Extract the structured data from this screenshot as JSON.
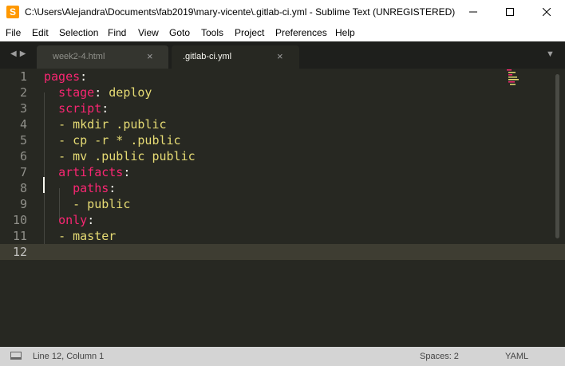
{
  "window": {
    "title": "C:\\Users\\Alejandra\\Documents\\fab2019\\mary-vicente\\.gitlab-ci.yml - Sublime Text (UNREGISTERED)",
    "app_icon_letter": "S"
  },
  "menu": [
    "File",
    "Edit",
    "Selection",
    "Find",
    "View",
    "Goto",
    "Tools",
    "Project",
    "Preferences",
    "Help"
  ],
  "tabs": [
    {
      "label": "week2-4.html",
      "close": "×"
    },
    {
      "label": ".gitlab-ci.yml",
      "close": "×"
    }
  ],
  "editor": {
    "line_numbers": [
      "1",
      "2",
      "3",
      "4",
      "5",
      "6",
      "7",
      "8",
      "9",
      "10",
      "11",
      "12"
    ],
    "lines": [
      {
        "key": "pages",
        "punct": ":"
      },
      {
        "indent": "  ",
        "key": "stage",
        "punct": ": ",
        "value": "deploy"
      },
      {
        "indent": "  ",
        "key": "script",
        "punct": ":"
      },
      {
        "indent": "  ",
        "value": "- mkdir .public"
      },
      {
        "indent": "  ",
        "value": "- cp -r * .public"
      },
      {
        "indent": "  ",
        "value": "- mv .public public"
      },
      {
        "indent": "  ",
        "key": "artifacts",
        "punct": ":"
      },
      {
        "indent": "    ",
        "key": "paths",
        "punct": ":"
      },
      {
        "indent": "    ",
        "value": "- public"
      },
      {
        "indent": "  ",
        "key": "only",
        "punct": ":"
      },
      {
        "indent": "  ",
        "value": "- master"
      },
      {
        "indent": ""
      }
    ]
  },
  "status": {
    "position": "Line 12, Column 1",
    "spaces": "Spaces: 2",
    "syntax": "YAML"
  },
  "colors": {
    "keyword": "#f92672",
    "string": "#e6db74",
    "background": "#272822"
  }
}
